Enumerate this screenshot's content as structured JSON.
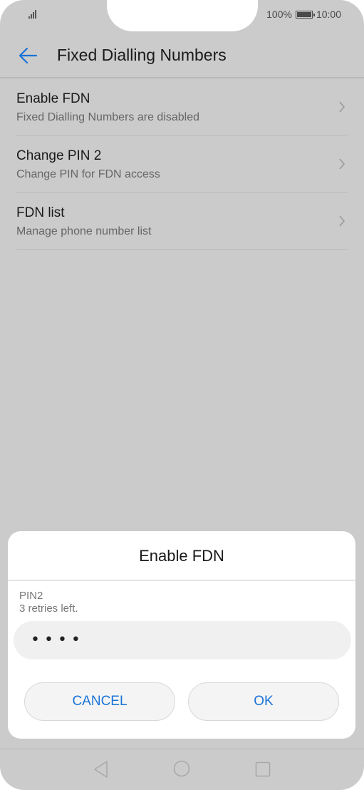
{
  "status_bar": {
    "battery_percent": "100%",
    "time": "10:00"
  },
  "header": {
    "title": "Fixed Dialling Numbers"
  },
  "list": {
    "items": [
      {
        "title": "Enable FDN",
        "subtitle": "Fixed Dialling Numbers are disabled"
      },
      {
        "title": "Change PIN 2",
        "subtitle": "Change PIN for FDN access"
      },
      {
        "title": "FDN list",
        "subtitle": "Manage phone number list"
      }
    ]
  },
  "dialog": {
    "title": "Enable FDN",
    "field_label": "PIN2",
    "retries_text": "3 retries left.",
    "pin_value": "••••",
    "cancel_label": "CANCEL",
    "ok_label": "OK"
  },
  "colors": {
    "accent": "#1a73d6",
    "overlay_background": "#cbcbcb",
    "dialog_background": "#ffffff"
  },
  "icons": {
    "back": "arrow-left-icon",
    "chevron": "chevron-right-icon",
    "nav_back": "triangle-back-icon",
    "nav_home": "circle-home-icon",
    "nav_recent": "square-recent-icon"
  }
}
